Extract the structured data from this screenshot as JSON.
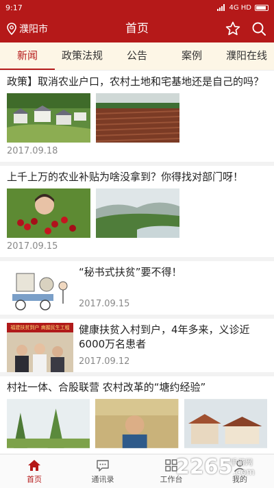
{
  "status_bar": {
    "time": "9:17",
    "network": "4G HD"
  },
  "header": {
    "location": "濮阳市",
    "title": "首页",
    "location_icon": "map-pin-icon",
    "star_icon": "star-icon",
    "search_icon": "search-icon"
  },
  "tabs": [
    {
      "label": "新闻",
      "active": true
    },
    {
      "label": "政策法规"
    },
    {
      "label": "公告"
    },
    {
      "label": "案例"
    },
    {
      "label": "濮阳在线"
    }
  ],
  "articles": [
    {
      "title": "政策】取消农业户口，农村土地和宅基地还是自己的吗？",
      "date": "2017.09.18"
    },
    {
      "title": "上千上万的农业补贴为啥没拿到？你得找对部门呀！",
      "date": "2017.09.15"
    },
    {
      "title": "“秘书式扶贫”要不得！",
      "date": "2017.09.15"
    },
    {
      "title": "健康扶贫入村到户，4年多来，义诊近6000万名患者",
      "date": "2017.09.12",
      "image_banner": "福建扶贫到户 病握民生工程"
    },
    {
      "title": "村社一体、合股联营 农村改革的“塘约经验”"
    }
  ],
  "bottom_nav": [
    {
      "label": "首页",
      "icon": "home-icon",
      "active": true
    },
    {
      "label": "通讯录",
      "icon": "chat-icon"
    },
    {
      "label": "工作台",
      "icon": "grid-icon"
    },
    {
      "label": "我的",
      "icon": "person-icon"
    }
  ],
  "watermark": {
    "text": "2265",
    "sub": "手游网",
    "domain": ".com"
  },
  "colors": {
    "brand_red": "#b51919",
    "tab_bg": "#fdf6e6",
    "divider": "#f2f2f2"
  }
}
